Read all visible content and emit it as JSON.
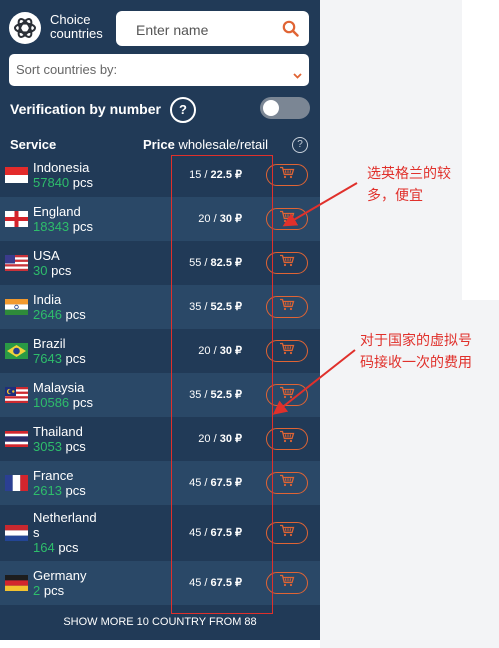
{
  "header": {
    "brand_line1": "Choice",
    "brand_line2": "countries",
    "search_placeholder": "Enter name"
  },
  "sort": {
    "label": "Sort countries by:"
  },
  "verification": {
    "label": "Verification by number",
    "help": "?",
    "enabled": false
  },
  "table": {
    "col_service": "Service",
    "col_price_bold": "Price",
    "col_price_rest": "wholesale/retail",
    "help": "?"
  },
  "rows": [
    {
      "name": "Indonesia",
      "count": "57840",
      "unit": "pcs",
      "wholesale": "15",
      "retail": "22.5 ₽",
      "flag": "indonesia"
    },
    {
      "name": "England",
      "count": "18343",
      "unit": "pcs",
      "wholesale": "20",
      "retail": "30 ₽",
      "flag": "england"
    },
    {
      "name": "USA",
      "count": "30",
      "unit": "pcs",
      "wholesale": "55",
      "retail": "82.5 ₽",
      "flag": "usa"
    },
    {
      "name": "India",
      "count": "2646",
      "unit": "pcs",
      "wholesale": "35",
      "retail": "52.5 ₽",
      "flag": "india"
    },
    {
      "name": "Brazil",
      "count": "7643",
      "unit": "pcs",
      "wholesale": "20",
      "retail": "30 ₽",
      "flag": "brazil"
    },
    {
      "name": "Malaysia",
      "count": "10586",
      "unit": "pcs",
      "wholesale": "35",
      "retail": "52.5 ₽",
      "flag": "malaysia"
    },
    {
      "name": "Thailand",
      "count": "3053",
      "unit": "pcs",
      "wholesale": "20",
      "retail": "30 ₽",
      "flag": "thailand"
    },
    {
      "name": "France",
      "count": "2613",
      "unit": "pcs",
      "wholesale": "45",
      "retail": "67.5 ₽",
      "flag": "france"
    },
    {
      "name_line1": "Netherland",
      "name_line2": "s",
      "count": "164",
      "unit": "pcs",
      "wholesale": "45",
      "retail": "67.5 ₽",
      "flag": "netherlands"
    },
    {
      "name": "Germany",
      "count": "2",
      "unit": "pcs",
      "wholesale": "45",
      "retail": "67.5 ₽",
      "flag": "germany"
    }
  ],
  "footer": {
    "show_more": "SHOW MORE 10 COUNTRY FROM 88"
  },
  "annotations": {
    "note1_line1": "选英格兰的较",
    "note1_line2": "多，便宜",
    "note2_line1": "对于国家的虚拟号",
    "note2_line2": "码接收一次的费用"
  },
  "colors": {
    "panel_bg": "#213a57",
    "row_alt_bg": "#2a4867",
    "count_green": "#2ebd6b",
    "accent_orange": "#e06434",
    "annotation_red": "#e0302b"
  }
}
